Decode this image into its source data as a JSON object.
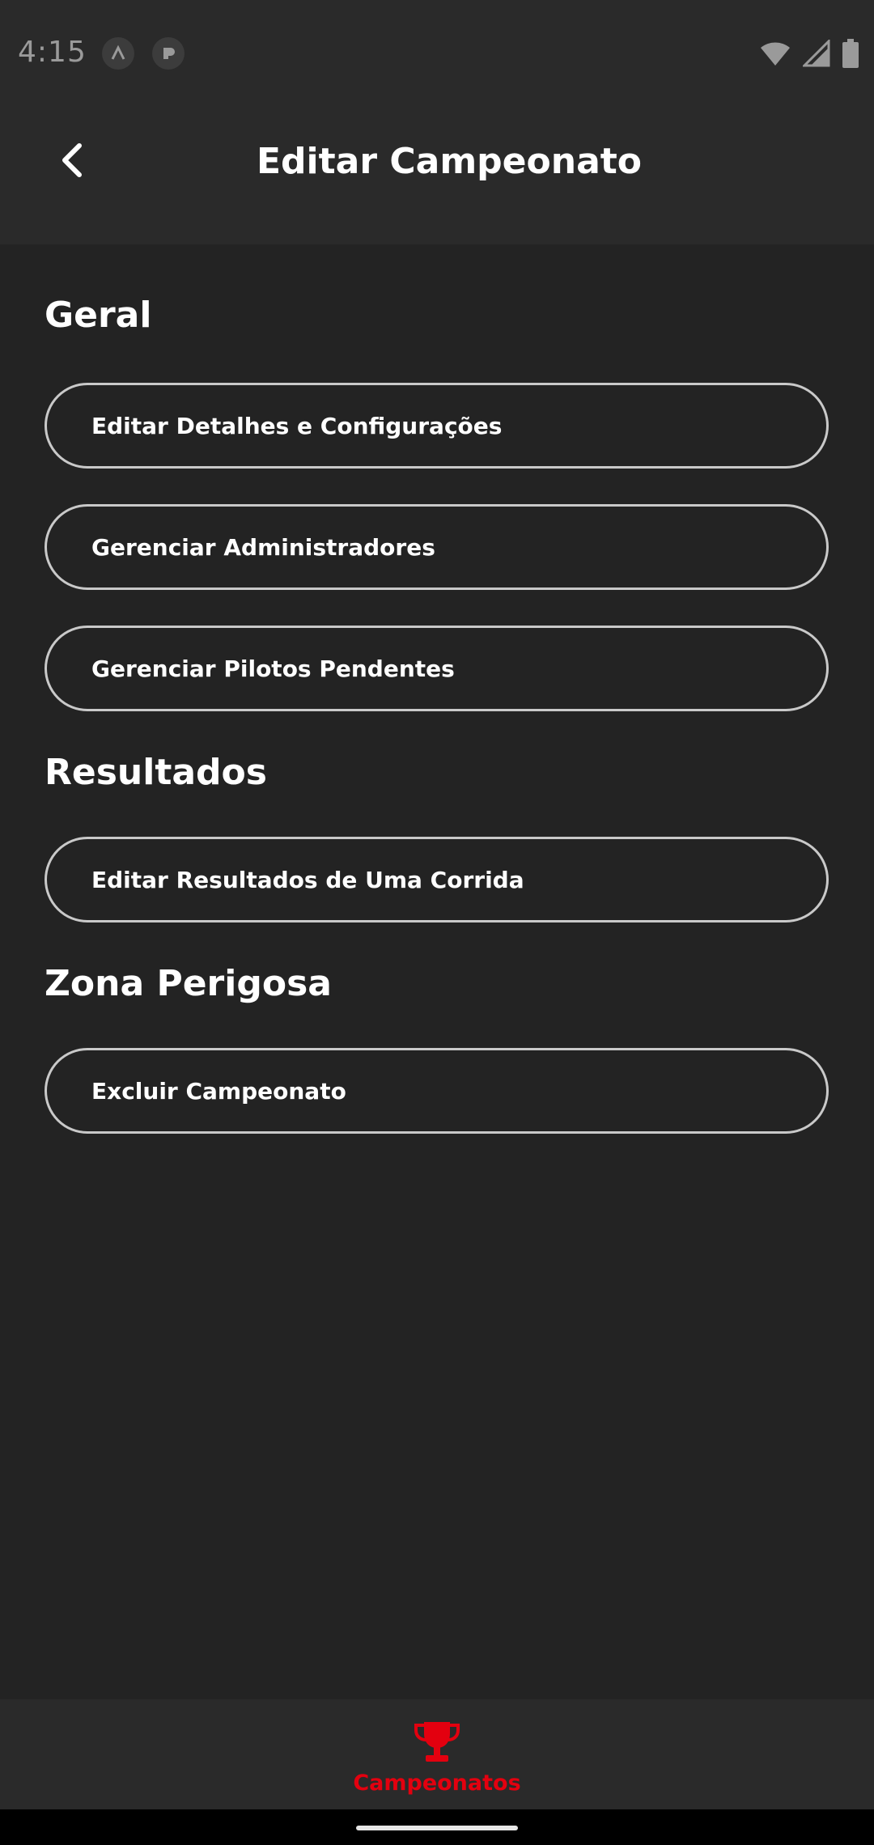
{
  "status_bar": {
    "time": "4:15",
    "icons": [
      "app-a-icon",
      "app-p-icon",
      "wifi-icon",
      "signal-icon",
      "battery-icon"
    ]
  },
  "header": {
    "title": "Editar Campeonato",
    "back_icon": "chevron-left-icon"
  },
  "sections": {
    "geral": {
      "title": "Geral",
      "items": [
        "Editar Detalhes e Configurações",
        "Gerenciar Administradores",
        "Gerenciar Pilotos Pendentes"
      ]
    },
    "resultados": {
      "title": "Resultados",
      "items": [
        "Editar Resultados de Uma Corrida"
      ]
    },
    "zona_perigosa": {
      "title": "Zona Perigosa",
      "items": [
        "Excluir Campeonato"
      ]
    }
  },
  "bottom_nav": {
    "active_label": "Campeonatos",
    "icon": "trophy-icon"
  },
  "colors": {
    "background": "#232323",
    "bar": "#2a2a2a",
    "accent": "#e3000f",
    "border": "#c9c9c9"
  }
}
